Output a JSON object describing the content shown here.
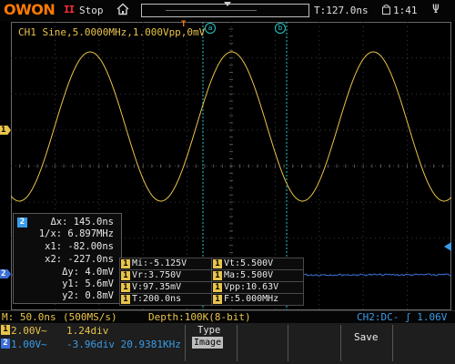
{
  "header": {
    "logo": "OWON",
    "pause_symbol": "II",
    "run_state": "Stop",
    "trigger_time": "T:127.0ns",
    "clock": "1:41"
  },
  "waveform": {
    "ch1_info": "CH1 Sine,5.0000MHz,1.000Vpp,0mV",
    "ch1_marker": "1",
    "ch2_marker": "2",
    "trigger_marker": "T",
    "cursor_a": "a",
    "cursor_b": "b"
  },
  "cursor_panel": {
    "badge": "2",
    "rows": [
      "Δx: 145.0ns",
      "1/x: 6.897MHz",
      "x1: -82.00ns",
      "x2: -227.0ns",
      "Δy: 4.0mV",
      "y1: 5.6mV",
      "y2: 0.8mV"
    ]
  },
  "measurements": [
    {
      "ch": "1",
      "text": "Mi:-5.125V"
    },
    {
      "ch": "1",
      "text": "Vt:5.500V"
    },
    {
      "ch": "1",
      "text": "Vr:3.750V"
    },
    {
      "ch": "1",
      "text": "Ma:5.500V"
    },
    {
      "ch": "1",
      "text": "V:97.35mV"
    },
    {
      "ch": "1",
      "text": "Vpp:10.63V"
    },
    {
      "ch": "1",
      "text": "T:200.0ns"
    },
    {
      "ch": "1",
      "text": "F:5.000MHz"
    }
  ],
  "status": {
    "timebase": "M: 50.0ns",
    "sample_rate": "(500MS/s)",
    "depth": "Depth:100K(8-bit)",
    "trigger": "CH2:DC-  ʃ 1.06V"
  },
  "channels": [
    {
      "badge": "1",
      "volts_div": "2.00V~",
      "position": "1.24div",
      "color": "#e8c44a"
    },
    {
      "badge": "2",
      "volts_div": "1.00V~",
      "position": "-3.96div 20.9381KHz",
      "color": "#3a9ce8"
    }
  ],
  "softkeys": {
    "type_label": "Type",
    "type_value": "Image",
    "save_label": "Save"
  },
  "colors": {
    "ch1": "#e8c44a",
    "ch2": "#3a9ce8",
    "cursor": "#27c7c7",
    "logo": "#ff7a00",
    "stop_symbol": "#ff3030"
  },
  "icons": [
    "home-icon",
    "clock-icon",
    "usb-icon"
  ]
}
